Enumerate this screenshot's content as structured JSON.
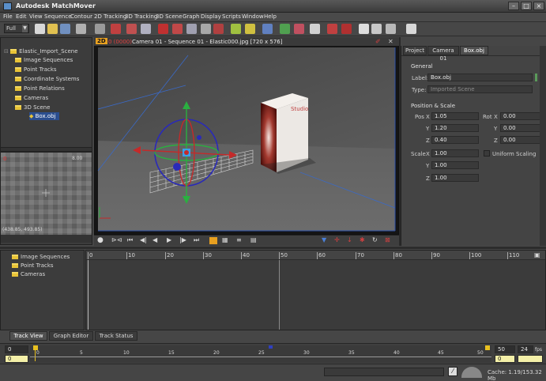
{
  "window": {
    "title": "Autodesk MatchMover"
  },
  "menu": [
    "File",
    "Edit",
    "View",
    "Sequence",
    "Contour",
    "2D Tracking",
    "3D Tracking",
    "3D Scene",
    "Graph",
    "Display",
    "Scripts",
    "Window",
    "Help"
  ],
  "toolbar": {
    "view_mode": "Full"
  },
  "scene_tree": {
    "items": [
      "Elastic_Import_Scene",
      "Image Sequences",
      "Point Tracks",
      "Coordinate Systems",
      "Point Relations",
      "Cameras",
      "3D Scene",
      "Box.obj"
    ]
  },
  "thumb": {
    "frame": "0",
    "zoom": "8.00",
    "coords": "(438.85, 493.85)"
  },
  "viewport": {
    "mode": "2D",
    "frame_label": "0 (0000)",
    "title": "Camera 01 - Sequence 01 - Elastic000.jpg [720 x 576]",
    "product_text": "Studio"
  },
  "attr": {
    "tabs": [
      "Project",
      "Camera 01",
      "Box.obj"
    ],
    "general_label": "General",
    "label_caption": "Label:",
    "label_value": "Box.obj",
    "type_caption": "Type:",
    "type_value": "Imported Scene",
    "pos_scale_label": "Position & Scale",
    "pos": {
      "caption": "Pos",
      "x": "1.05",
      "y": "1.20",
      "z": "0.40"
    },
    "rot": {
      "caption": "Rot",
      "x": "0.00",
      "y": "0.00",
      "z": "0.00"
    },
    "scale": {
      "caption": "Scale",
      "x": "1.00",
      "y": "1.00",
      "z": "1.00"
    },
    "axis": {
      "x": "X",
      "y": "Y",
      "z": "Z"
    },
    "uniform_scaling": "Uniform Scaling"
  },
  "track_tree": {
    "items": [
      "Image Sequences",
      "Point Tracks",
      "Cameras"
    ]
  },
  "ruler": [
    "0",
    "10",
    "20",
    "30",
    "40",
    "50",
    "60",
    "70",
    "80",
    "90",
    "100",
    "110"
  ],
  "bottom_tabs": [
    "Track View",
    "Graph Editor",
    "Track Status"
  ],
  "timeline": {
    "start": "0",
    "start2": "0",
    "end": "50",
    "fps": "24",
    "fps_label": "fps",
    "end2": "0",
    "ticks": [
      "0",
      "5",
      "10",
      "15",
      "20",
      "25",
      "30",
      "35",
      "40",
      "45",
      "50"
    ]
  },
  "status": {
    "cache": "Cache: 1.19/153.32 Mb"
  }
}
